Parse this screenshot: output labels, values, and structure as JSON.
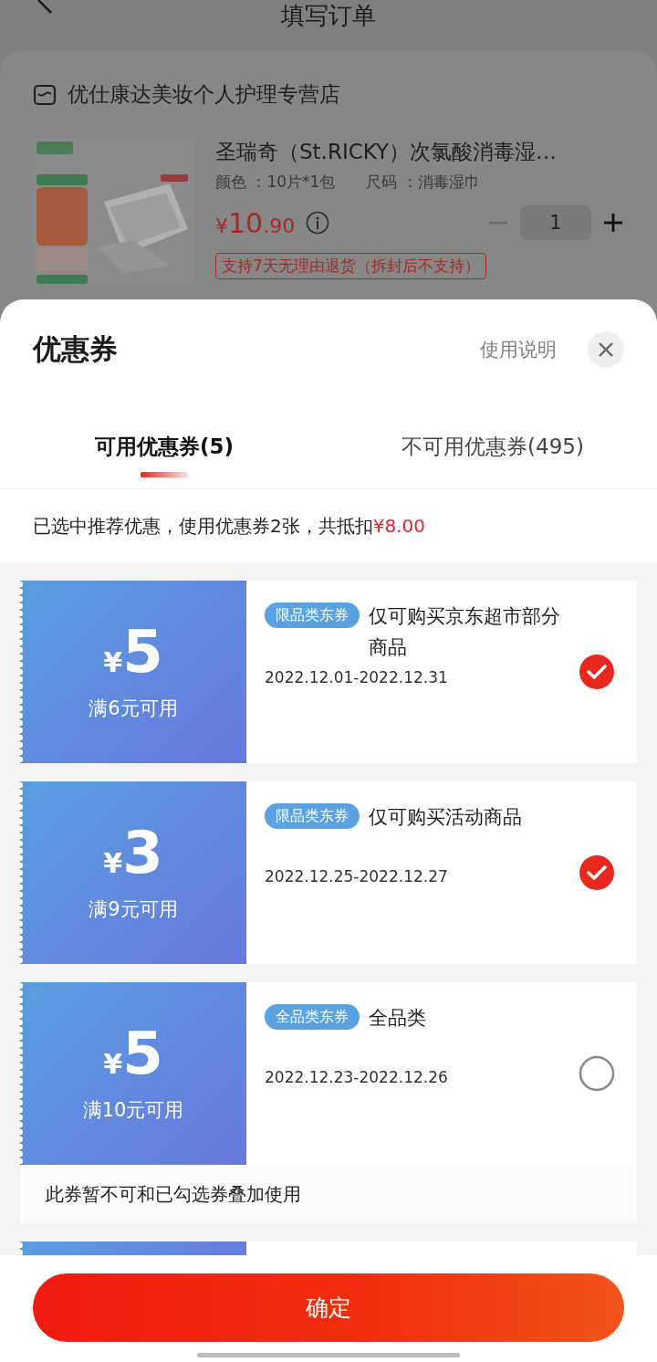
{
  "page": {
    "title": "填写订单",
    "store": "优仕康达美妆个人护理专营店",
    "product": {
      "name": "圣瑞奇（St.RICKY）次氯酸消毒湿…",
      "specs": [
        "颜色 ：10片*1包",
        "尺码 ：消毒湿巾"
      ],
      "currency": "¥",
      "price_integer": "10",
      "price_decimal": ".90",
      "quantity": "1",
      "policy": "支持7天无理由退货（拆封后不支持）"
    }
  },
  "sheet": {
    "title": "优惠券",
    "help": "使用说明",
    "tabs": [
      {
        "label": "可用优惠券(5)",
        "selected": true
      },
      {
        "label": "不可用优惠券(495)",
        "selected": false
      }
    ],
    "summary": "已选中推荐优惠，使用优惠券2张，共抵扣",
    "summary_amount": "¥8.00",
    "coupons": [
      {
        "currency": "¥",
        "amount": "5",
        "condition": "满6元可用",
        "tag": "限品类东券",
        "title": "仅可购买京东超市部分商品",
        "validity": "2022.12.01-2022.12.31",
        "selected": true
      },
      {
        "currency": "¥",
        "amount": "3",
        "condition": "满9元可用",
        "tag": "限品类东券",
        "title": "仅可购买活动商品",
        "validity": "2022.12.25-2022.12.27",
        "selected": true
      },
      {
        "currency": "¥",
        "amount": "5",
        "condition": "满10元可用",
        "tag": "全品类东券",
        "title": "全品类",
        "validity": "2022.12.23-2022.12.26",
        "selected": false,
        "note": "此券暂不可和已勾选券叠加使用"
      }
    ],
    "confirm": "确定"
  }
}
